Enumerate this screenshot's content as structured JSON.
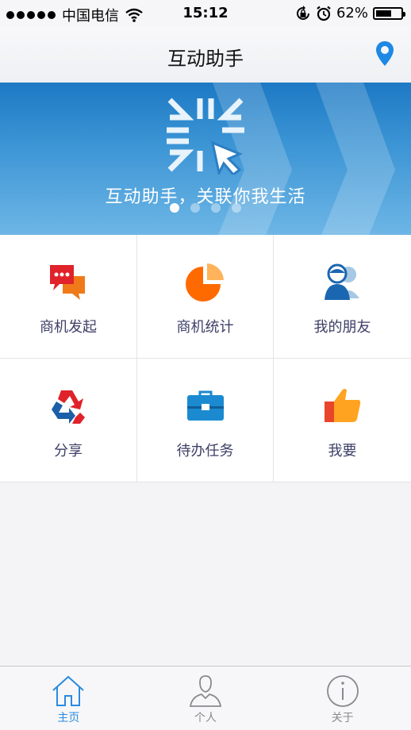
{
  "status_bar": {
    "carrier": "中国电信",
    "time": "15:12",
    "battery": "62%",
    "battery_level": 0.62
  },
  "nav": {
    "title": "互动助手"
  },
  "banner": {
    "slogan": "互动助手，关联你我生活",
    "page_count": 4,
    "active_page": 1
  },
  "grid": {
    "items": [
      {
        "label": "商机发起"
      },
      {
        "label": "商机统计"
      },
      {
        "label": "我的朋友"
      },
      {
        "label": "分享"
      },
      {
        "label": "待办任务"
      },
      {
        "label": "我要"
      }
    ]
  },
  "tab_bar": {
    "tabs": [
      {
        "label": "主页",
        "active": true
      },
      {
        "label": "个人",
        "active": false
      },
      {
        "label": "关于",
        "active": false
      }
    ]
  },
  "colors": {
    "accent": "#2a8be0",
    "banner": "#1d79c4",
    "label": "#3c3f66"
  }
}
